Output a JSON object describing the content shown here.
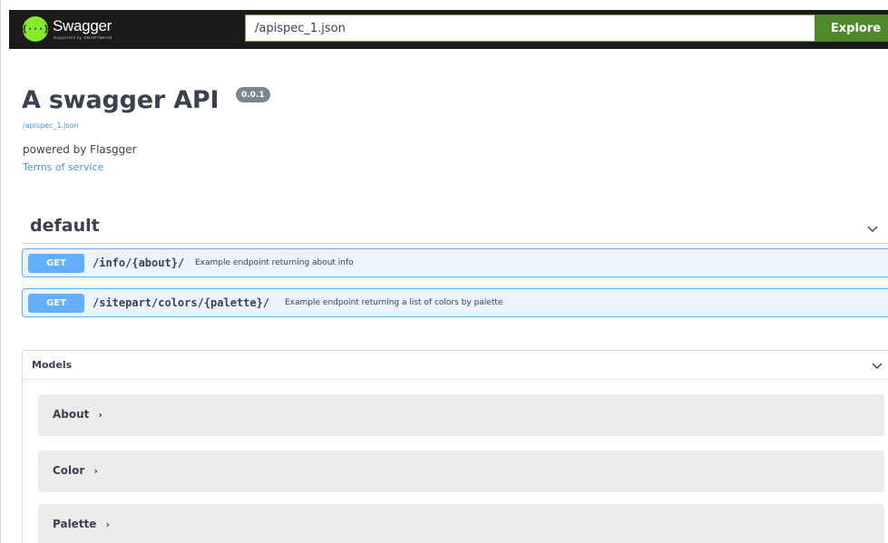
{
  "topbar": {
    "brand_name": "Swagger",
    "brand_sub": "Supported by SMARTBEAR",
    "logo_glyph": "{···}",
    "url_value": "/apispec_1.json",
    "explore_label": "Explore"
  },
  "info": {
    "title": "A swagger API",
    "version": "0.0.1",
    "spec_link": "/apispec_1.json",
    "description": "powered by Flasgger",
    "tos_link": "Terms of service"
  },
  "tag": {
    "name": "default",
    "chevron_icon": "chevron-down-icon"
  },
  "operations": [
    {
      "method": "GET",
      "path": "/info/{about}/",
      "summary": "Example endpoint returning about info"
    },
    {
      "method": "GET",
      "path": "/sitepart/colors/{palette}/",
      "summary": "Example endpoint returning a list of colors by palette"
    }
  ],
  "models": {
    "title": "Models",
    "items": [
      {
        "name": "About",
        "arrow": "›"
      },
      {
        "name": "Color",
        "arrow": "›"
      },
      {
        "name": "Palette",
        "arrow": "›"
      }
    ]
  },
  "colors": {
    "topbar_bg": "#1b1b1b",
    "logo_green": "#85ea2d",
    "explore_green": "#4e8a2a",
    "get_blue": "#61affe",
    "get_bg": "#ebf3fb",
    "link_blue": "#4990e2",
    "text": "#3b4151"
  }
}
